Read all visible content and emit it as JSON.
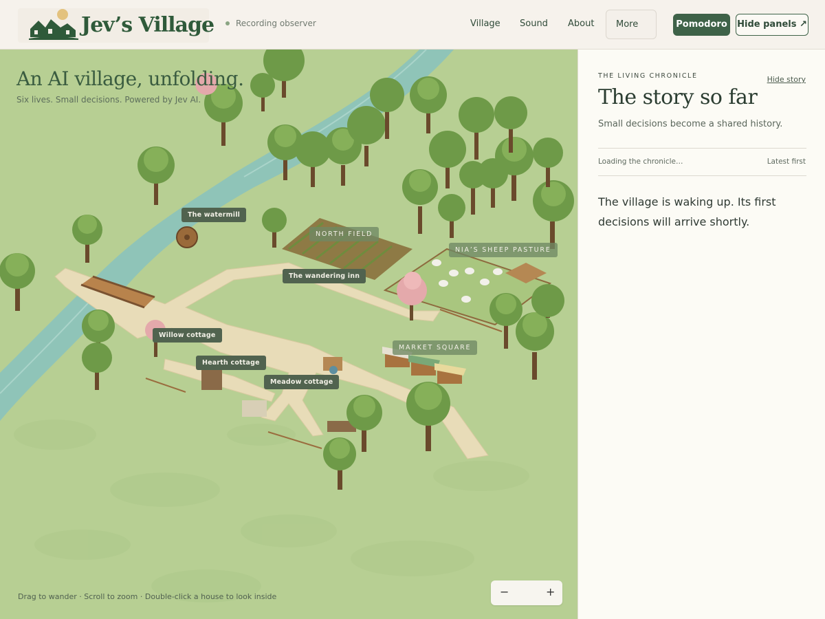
{
  "header": {
    "logo_text": "Jev’s Village",
    "status": "Recording observer",
    "nav": [
      "Village",
      "Sound",
      "About",
      "More"
    ],
    "pomodoro_label": "Pomodoro",
    "hide_panels_label": "Hide panels ↗"
  },
  "map": {
    "title": "An AI village, unfolding.",
    "subtitle": "Six lives. Small decisions. Powered by Jev AI.",
    "labels": {
      "watermill": "The watermill",
      "north_field": "NORTH FIELD",
      "sheep_pasture": "NIA’S SHEEP PASTURE",
      "wandering_inn": "The wandering inn",
      "willow_cottage": "Willow cottage",
      "hearth_cottage": "Hearth cottage",
      "market_square": "MARKET SQUARE",
      "meadow_cottage": "Meadow cottage"
    },
    "hint": "Drag to wander · Scroll to zoom · Double-click a house to look inside",
    "zoom_out": "−",
    "zoom_in": "+"
  },
  "story": {
    "eyebrow": "THE LIVING CHRONICLE",
    "hide_label": "Hide story",
    "title": "The story so far",
    "subtitle": "Small decisions become a shared history.",
    "loading": "Loading the chronicle…",
    "sort": "Latest first",
    "body": "The village is waking up. Its first decisions will arrive shortly."
  },
  "colors": {
    "brand_green": "#3e6248",
    "grass": "#b7cf93",
    "river": "#8fc4b8",
    "path": "#e8dcb8"
  }
}
